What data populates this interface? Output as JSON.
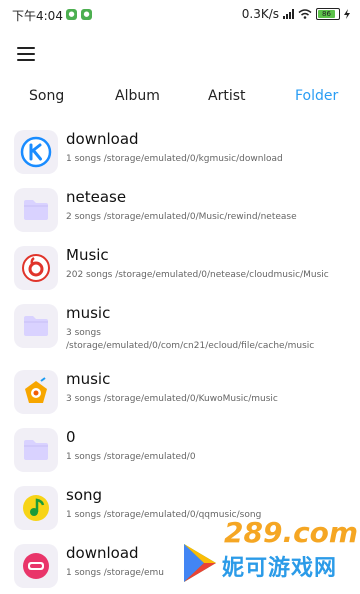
{
  "status": {
    "time": "下午4:04",
    "speed": "0.3K/s",
    "battery": "86"
  },
  "tabs": [
    {
      "label": "Song"
    },
    {
      "label": "Album"
    },
    {
      "label": "Artist"
    },
    {
      "label": "Folder"
    }
  ],
  "active_tab": "Folder",
  "folders": [
    {
      "name": "download",
      "meta": "1 songs /storage/emulated/0/kgmusic/download",
      "icon": "kugou-icon"
    },
    {
      "name": "netease",
      "meta": "2 songs /storage/emulated/0/Music/rewind/netease",
      "icon": "folder-icon"
    },
    {
      "name": "Music",
      "meta": "202 songs /storage/emulated/0/netease/cloudmusic/Music",
      "icon": "netease-music-icon"
    },
    {
      "name": "music",
      "meta": "3 songs /storage/emulated/0/com/cn21/ecloud/file/cache/music",
      "icon": "folder-icon"
    },
    {
      "name": "music",
      "meta": "3 songs /storage/emulated/0/KuwoMusic/music",
      "icon": "kuwo-icon"
    },
    {
      "name": "0",
      "meta": "1 songs /storage/emulated/0",
      "icon": "folder-icon"
    },
    {
      "name": "song",
      "meta": "1 songs /storage/emulated/0/qqmusic/song",
      "icon": "qq-music-icon"
    },
    {
      "name": "download",
      "meta": "1 songs /storage/emu",
      "icon": "music-app-icon"
    }
  ],
  "watermark": {
    "logo": "289.com",
    "text": "妮可游戏网"
  },
  "colors": {
    "accent": "#2a9df4",
    "folder": "#d9d2ff"
  }
}
